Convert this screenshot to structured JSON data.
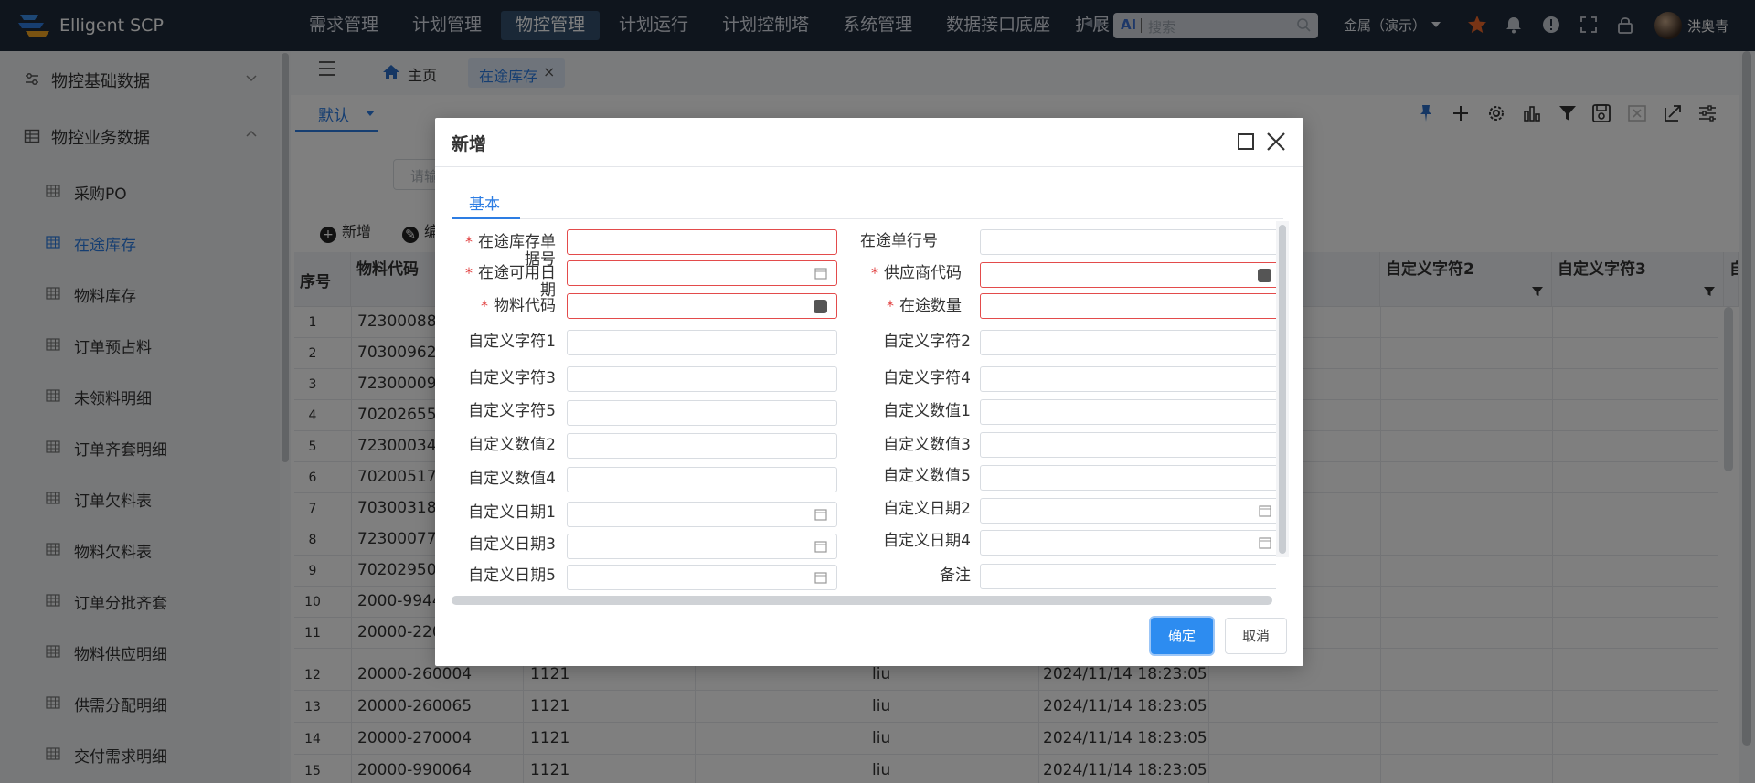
{
  "app": {
    "brand": "Elligent SCP",
    "nav": [
      "需求管理",
      "计划管理",
      "物控管理",
      "计划运行",
      "计划控制塔",
      "系统管理",
      "数据接口底座",
      "扩展"
    ],
    "nav_active": "物控管理",
    "search_ai": "AI",
    "search_placeholder": "搜索",
    "tenant": "金属（演示）",
    "user_name": "洪奥青"
  },
  "sidebar": {
    "groups": [
      {
        "label": "物控基础数据",
        "expanded": false
      },
      {
        "label": "物控业务数据",
        "expanded": true
      }
    ],
    "items": [
      {
        "label": "采购PO"
      },
      {
        "label": "在途库存",
        "active": true
      },
      {
        "label": "物料库存"
      },
      {
        "label": "订单预占料"
      },
      {
        "label": "未领料明细"
      },
      {
        "label": "订单齐套明细"
      },
      {
        "label": "订单欠料表"
      },
      {
        "label": "物料欠料表"
      },
      {
        "label": "订单分批齐套"
      },
      {
        "label": "物料供应明细"
      },
      {
        "label": "供需分配明细"
      },
      {
        "label": "交付需求明细"
      }
    ]
  },
  "tabs": {
    "home": "主页",
    "current": "在途库存",
    "close": "×"
  },
  "view": {
    "name": "默认"
  },
  "filter": {
    "placeholder": "请输"
  },
  "actions": {
    "add": "新增",
    "edit": "编"
  },
  "table": {
    "headers": [
      "序号",
      "物料代码",
      "自定义字符2",
      "自定义字符3",
      "自"
    ],
    "rows": [
      {
        "no": "1",
        "code": "72300088"
      },
      {
        "no": "2",
        "code": "70300962"
      },
      {
        "no": "3",
        "code": "72300009"
      },
      {
        "no": "4",
        "code": "70202655"
      },
      {
        "no": "5",
        "code": "72300034"
      },
      {
        "no": "6",
        "code": "70200517"
      },
      {
        "no": "7",
        "code": "70300318"
      },
      {
        "no": "8",
        "code": "72300077"
      },
      {
        "no": "9",
        "code": "70202950"
      },
      {
        "no": "10",
        "code": "2000-9944"
      },
      {
        "no": "11",
        "code": "20000-220"
      },
      {
        "no": "12",
        "code": "20000-260004",
        "qty": "1121",
        "user": "liu",
        "time": "2024/11/14 18:23:05"
      },
      {
        "no": "13",
        "code": "20000-260065",
        "qty": "1121",
        "user": "liu",
        "time": "2024/11/14 18:23:05"
      },
      {
        "no": "14",
        "code": "20000-270004",
        "qty": "1121",
        "user": "liu",
        "time": "2024/11/14 18:23:05"
      },
      {
        "no": "15",
        "code": "20000-990064",
        "qty": "1121",
        "user": "liu",
        "time": "2024/11/14 18:23:05"
      }
    ]
  },
  "modal": {
    "title": "新增",
    "tab": "基本",
    "fields": {
      "f1": {
        "label": "在途库存单据号",
        "required": true,
        "value": ""
      },
      "f2": {
        "label": "在途单行号",
        "required": false,
        "value": ""
      },
      "f3": {
        "label": "在途可用日期",
        "required": true,
        "value": ""
      },
      "f4": {
        "label": "供应商代码",
        "required": true,
        "value": ""
      },
      "f5": {
        "label": "物料代码",
        "required": true,
        "value": ""
      },
      "f6": {
        "label": "在途数量",
        "required": true,
        "value": ""
      },
      "f7": {
        "label": "自定义字符1",
        "value": ""
      },
      "f8": {
        "label": "自定义字符2",
        "value": ""
      },
      "f9": {
        "label": "自定义字符3",
        "value": ""
      },
      "f10": {
        "label": "自定义字符4",
        "value": ""
      },
      "f11": {
        "label": "自定义字符5",
        "value": ""
      },
      "f12": {
        "label": "自定义数值1",
        "value": ""
      },
      "f13": {
        "label": "自定义数值2",
        "value": ""
      },
      "f14": {
        "label": "自定义数值3",
        "value": ""
      },
      "f15": {
        "label": "自定义数值4",
        "value": ""
      },
      "f16": {
        "label": "自定义数值5",
        "value": ""
      },
      "f17": {
        "label": "自定义日期1",
        "value": ""
      },
      "f18": {
        "label": "自定义日期2",
        "value": ""
      },
      "f19": {
        "label": "自定义日期3",
        "value": ""
      },
      "f20": {
        "label": "自定义日期4",
        "value": ""
      },
      "f21": {
        "label": "自定义日期5",
        "value": ""
      },
      "f22": {
        "label": "备注",
        "value": ""
      }
    },
    "ok": "确定",
    "cancel": "取消"
  },
  "colors": {
    "accent": "#2d8cf0",
    "topbar": "#1e2a3a",
    "required": "#e03c3c",
    "error_border": "#e34b4b"
  }
}
